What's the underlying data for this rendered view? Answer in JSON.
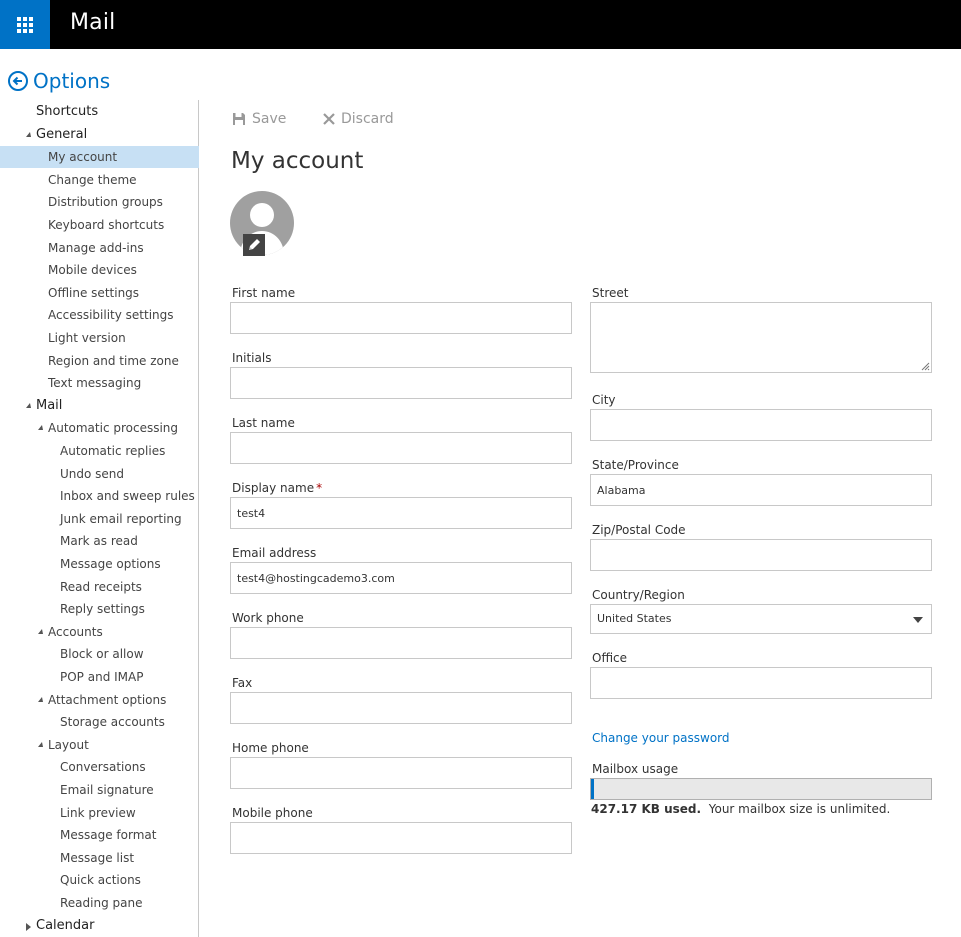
{
  "app": {
    "title": "Mail"
  },
  "options": {
    "title": "Options"
  },
  "sidebar": {
    "items": [
      {
        "label": "Shortcuts",
        "level": 0,
        "caret": "none",
        "selected": false
      },
      {
        "label": "General",
        "level": 0,
        "caret": "open",
        "selected": false
      },
      {
        "label": "My account",
        "level": 1,
        "caret": "none",
        "selected": true
      },
      {
        "label": "Change theme",
        "level": 1,
        "caret": "none",
        "selected": false
      },
      {
        "label": "Distribution groups",
        "level": 1,
        "caret": "none",
        "selected": false
      },
      {
        "label": "Keyboard shortcuts",
        "level": 1,
        "caret": "none",
        "selected": false
      },
      {
        "label": "Manage add-ins",
        "level": 1,
        "caret": "none",
        "selected": false
      },
      {
        "label": "Mobile devices",
        "level": 1,
        "caret": "none",
        "selected": false
      },
      {
        "label": "Offline settings",
        "level": 1,
        "caret": "none",
        "selected": false
      },
      {
        "label": "Accessibility settings",
        "level": 1,
        "caret": "none",
        "selected": false
      },
      {
        "label": "Light version",
        "level": 1,
        "caret": "none",
        "selected": false
      },
      {
        "label": "Region and time zone",
        "level": 1,
        "caret": "none",
        "selected": false
      },
      {
        "label": "Text messaging",
        "level": 1,
        "caret": "none",
        "selected": false
      },
      {
        "label": "Mail",
        "level": 0,
        "caret": "open",
        "selected": false
      },
      {
        "label": "Automatic processing",
        "level": 1,
        "caret": "open",
        "selected": false
      },
      {
        "label": "Automatic replies",
        "level": 2,
        "caret": "none",
        "selected": false
      },
      {
        "label": "Undo send",
        "level": 2,
        "caret": "none",
        "selected": false
      },
      {
        "label": "Inbox and sweep rules",
        "level": 2,
        "caret": "none",
        "selected": false
      },
      {
        "label": "Junk email reporting",
        "level": 2,
        "caret": "none",
        "selected": false
      },
      {
        "label": "Mark as read",
        "level": 2,
        "caret": "none",
        "selected": false
      },
      {
        "label": "Message options",
        "level": 2,
        "caret": "none",
        "selected": false
      },
      {
        "label": "Read receipts",
        "level": 2,
        "caret": "none",
        "selected": false
      },
      {
        "label": "Reply settings",
        "level": 2,
        "caret": "none",
        "selected": false
      },
      {
        "label": "Accounts",
        "level": 1,
        "caret": "open",
        "selected": false
      },
      {
        "label": "Block or allow",
        "level": 2,
        "caret": "none",
        "selected": false
      },
      {
        "label": "POP and IMAP",
        "level": 2,
        "caret": "none",
        "selected": false
      },
      {
        "label": "Attachment options",
        "level": 1,
        "caret": "open",
        "selected": false
      },
      {
        "label": "Storage accounts",
        "level": 2,
        "caret": "none",
        "selected": false
      },
      {
        "label": "Layout",
        "level": 1,
        "caret": "open",
        "selected": false
      },
      {
        "label": "Conversations",
        "level": 2,
        "caret": "none",
        "selected": false
      },
      {
        "label": "Email signature",
        "level": 2,
        "caret": "none",
        "selected": false
      },
      {
        "label": "Link preview",
        "level": 2,
        "caret": "none",
        "selected": false
      },
      {
        "label": "Message format",
        "level": 2,
        "caret": "none",
        "selected": false
      },
      {
        "label": "Message list",
        "level": 2,
        "caret": "none",
        "selected": false
      },
      {
        "label": "Quick actions",
        "level": 2,
        "caret": "none",
        "selected": false
      },
      {
        "label": "Reading pane",
        "level": 2,
        "caret": "none",
        "selected": false
      },
      {
        "label": "Calendar",
        "level": 0,
        "caret": "closed",
        "selected": false
      }
    ]
  },
  "toolbar": {
    "save_label": "Save",
    "discard_label": "Discard"
  },
  "page": {
    "title": "My account"
  },
  "form": {
    "first_name": {
      "label": "First name",
      "value": ""
    },
    "initials": {
      "label": "Initials",
      "value": ""
    },
    "last_name": {
      "label": "Last name",
      "value": ""
    },
    "display_name": {
      "label": "Display name",
      "required_mark": "*",
      "value": "test4"
    },
    "email": {
      "label": "Email address",
      "value": "test4@hostingcademo3.com"
    },
    "work_phone": {
      "label": "Work phone",
      "value": ""
    },
    "fax": {
      "label": "Fax",
      "value": ""
    },
    "home_phone": {
      "label": "Home phone",
      "value": ""
    },
    "mobile_phone": {
      "label": "Mobile phone",
      "value": ""
    },
    "street": {
      "label": "Street",
      "value": ""
    },
    "city": {
      "label": "City",
      "value": ""
    },
    "state": {
      "label": "State/Province",
      "value": "Alabama"
    },
    "zip": {
      "label": "Zip/Postal Code",
      "value": ""
    },
    "country": {
      "label": "Country/Region",
      "value": "United States"
    },
    "office": {
      "label": "Office",
      "value": ""
    }
  },
  "password_link": "Change your password",
  "mailbox": {
    "label": "Mailbox usage",
    "used": "427.17 KB used.",
    "note": "Your mailbox size is unlimited.",
    "usage_fraction": 0.005
  },
  "colors": {
    "accent": "#0072c6",
    "topbar": "#000000",
    "selected": "#c7e0f4"
  }
}
